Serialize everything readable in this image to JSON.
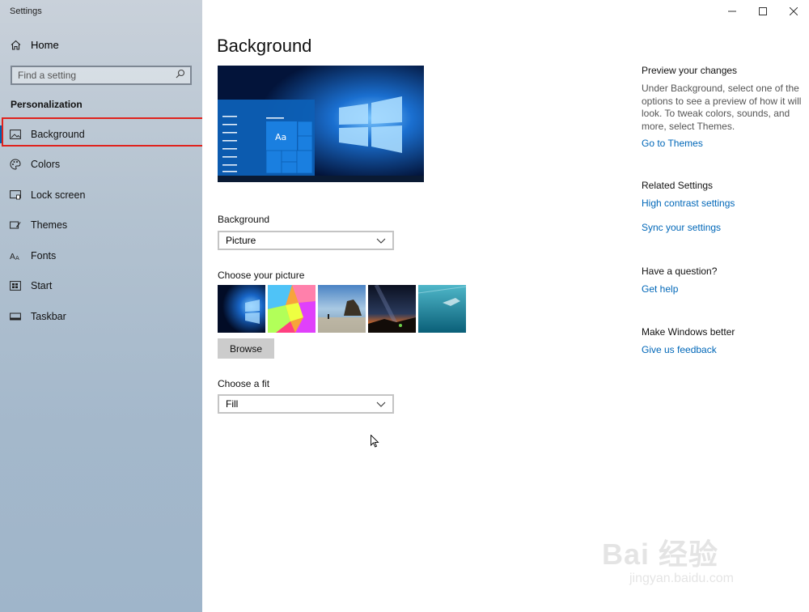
{
  "window": {
    "title": "Settings"
  },
  "sidebar": {
    "home_label": "Home",
    "search_placeholder": "Find a setting",
    "section_title": "Personalization",
    "items": [
      {
        "label": "Background",
        "icon": "picture-icon",
        "selected": true
      },
      {
        "label": "Colors",
        "icon": "palette-icon",
        "selected": false
      },
      {
        "label": "Lock screen",
        "icon": "lock-screen-icon",
        "selected": false
      },
      {
        "label": "Themes",
        "icon": "themes-icon",
        "selected": false
      },
      {
        "label": "Fonts",
        "icon": "fonts-icon",
        "selected": false
      },
      {
        "label": "Start",
        "icon": "start-icon",
        "selected": false
      },
      {
        "label": "Taskbar",
        "icon": "taskbar-icon",
        "selected": false
      }
    ]
  },
  "main": {
    "title": "Background",
    "preview_tile_text": "Aa",
    "background_label": "Background",
    "background_value": "Picture",
    "choose_picture_label": "Choose your picture",
    "browse_label": "Browse",
    "fit_label": "Choose a fit",
    "fit_value": "Fill"
  },
  "right": {
    "preview_head": "Preview your changes",
    "preview_text": "Under Background, select one of the options to see a preview of how it will look. To tweak colors, sounds, and more, select Themes.",
    "go_to_themes": "Go to Themes",
    "related_head": "Related Settings",
    "high_contrast": "High contrast settings",
    "sync_settings": "Sync your settings",
    "question_head": "Have a question?",
    "get_help": "Get help",
    "better_head": "Make Windows better",
    "feedback": "Give us feedback"
  },
  "watermark": {
    "line1": "Bai  经验",
    "line2": "jingyan.baidu.com"
  },
  "colors": {
    "accent": "#0063b1",
    "link": "#0067b8",
    "highlight": "#e0221d"
  }
}
